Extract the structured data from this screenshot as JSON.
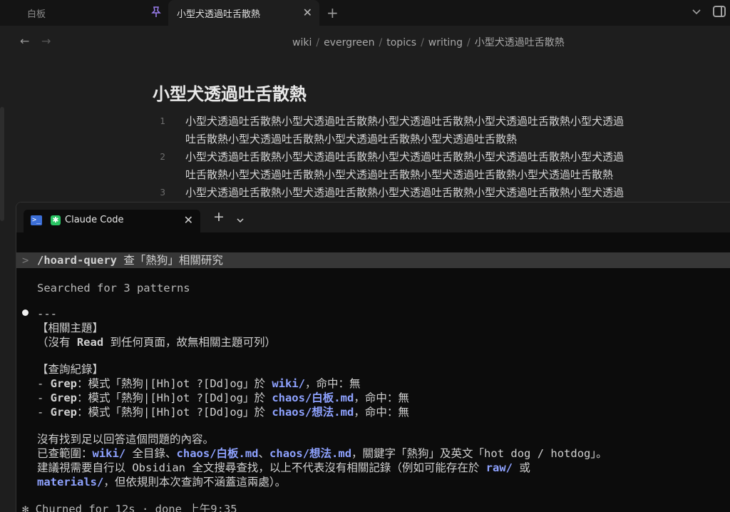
{
  "tabs": {
    "inactive_label": "白板",
    "active_label": "小型犬透過吐舌散熱",
    "new_tab_glyph": "+",
    "close_glyph": "✕"
  },
  "breadcrumb": [
    "wiki",
    "evergreen",
    "topics",
    "writing",
    "小型犬透過吐舌散熱"
  ],
  "note": {
    "title": "小型犬透過吐舌散熱",
    "lines": [
      {
        "num": "1",
        "text": "小型犬透過吐舌散熱小型犬透過吐舌散熱小型犬透過吐舌散熱小型犬透過吐舌散熱小型犬透過"
      },
      {
        "num": "",
        "text": "吐舌散熱小型犬透過吐舌散熱小型犬透過吐舌散熱小型犬透過吐舌散熱"
      },
      {
        "num": "2",
        "text": "小型犬透過吐舌散熱小型犬透過吐舌散熱小型犬透過吐舌散熱小型犬透過吐舌散熱小型犬透過"
      },
      {
        "num": "",
        "text": "吐舌散熱小型犬透過吐舌散熱小型犬透過吐舌散熱小型犬透過吐舌散熱小型犬透過吐舌散熱"
      },
      {
        "num": "3",
        "text": "小型犬透過吐舌散熱小型犬透過吐舌散熱小型犬透過吐舌散熱小型犬透過吐舌散熱小型犬透過"
      }
    ]
  },
  "terminal": {
    "tab_label": "Claude Code",
    "ps_icon_glyph": ">_",
    "cc_icon_glyph": "✱",
    "caret": ">",
    "prompt_cmd": "/hoard-query",
    "prompt_text": " 查「熱狗」相關研究",
    "searched": "Searched for 3 patterns",
    "hr": "---",
    "section1_title": "【相關主題】",
    "section1_body_a": "（沒有 ",
    "section1_body_read": "Read",
    "section1_body_b": " 到任何頁面，故無相關主題可列）",
    "section2_title": "【查詢紀錄】",
    "grep_lines": [
      {
        "prefix": "- ",
        "tool": "Grep",
        "mid": "：模式「熱狗|[Hh]ot ?[Dd]og」於 ",
        "path": "wiki/",
        "result": "，命中：無"
      },
      {
        "prefix": "- ",
        "tool": "Grep",
        "mid": "：模式「熱狗|[Hh]ot ?[Dd]og」於 ",
        "path": "chaos/白板.md",
        "result": "，命中：無"
      },
      {
        "prefix": "- ",
        "tool": "Grep",
        "mid": "：模式「熱狗|[Hh]ot ?[Dd]og」於 ",
        "path": "chaos/想法.md",
        "result": "，命中：無"
      }
    ],
    "summary1": "沒有找到足以回答這個問題的內容。",
    "summary2_a": "已查範圍：",
    "summary2_p1": "wiki/",
    "summary2_b": " 全目錄、",
    "summary2_p2": "chaos/白板.md",
    "summary2_c": "、",
    "summary2_p3": "chaos/想法.md",
    "summary2_d": "，關鍵字「熱狗」及英文「hot dog / hotdog」。",
    "summary3_a": "建議視需要自行以 Obsidian 全文搜尋查找，以上不代表沒有相關記錄（例如可能存在於 ",
    "summary3_p": "raw/",
    "summary3_b": " 或",
    "summary4_p": "materials/",
    "summary4_b": "，但依規則本次查詢不涵蓋這兩處）。",
    "footer": "✻ Churned for 12s · done 上午9:35"
  },
  "colors": {
    "accent_path": "#8ea2ff",
    "pin": "#9b7ef0",
    "cc_icon": "#29c463",
    "ps_icon": "#3c6fd8"
  }
}
